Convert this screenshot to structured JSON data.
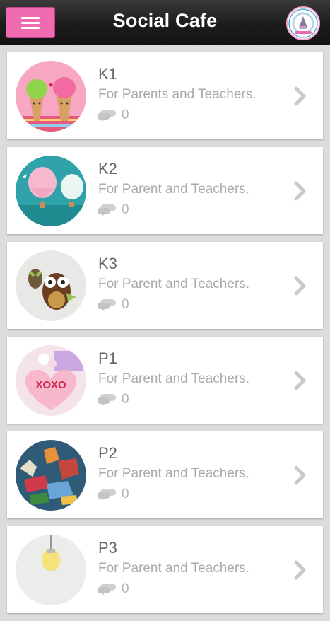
{
  "header": {
    "title": "Social Cafe",
    "menu_icon": "hamburger-menu-icon",
    "logo_icon": "school-logo-icon"
  },
  "colors": {
    "accent": "#f06bb0",
    "header_bg": "#1c1c1c",
    "page_bg": "#dcdcdc",
    "title_text": "#666666",
    "subtitle_text": "#aaaaaa"
  },
  "cafes": [
    {
      "title": "K1",
      "subtitle": "For Parents and Teachers.",
      "comments": "0",
      "image": "ice-cream-cones"
    },
    {
      "title": "K2",
      "subtitle": "For Parent and Teachers.",
      "comments": "0",
      "image": "hot-air-balloons"
    },
    {
      "title": "K3",
      "subtitle": "For Parent and Teachers.",
      "comments": "0",
      "image": "owl-toys"
    },
    {
      "title": "P1",
      "subtitle": "For Parent and Teachers.",
      "comments": "0",
      "image": "xoxo-heart"
    },
    {
      "title": "P2",
      "subtitle": "For Parent and Teachers.",
      "comments": "0",
      "image": "fabric-animals"
    },
    {
      "title": "P3",
      "subtitle": "For Parent and Teachers.",
      "comments": "0",
      "image": "light-bulb"
    }
  ]
}
